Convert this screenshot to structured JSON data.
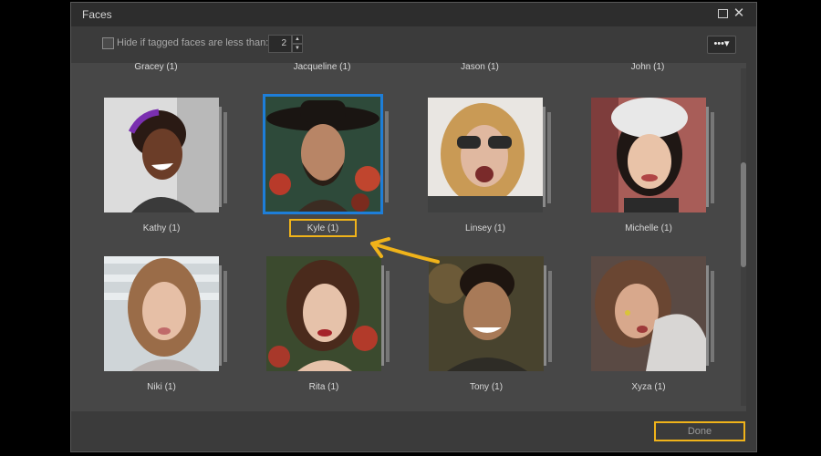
{
  "window": {
    "title": "Faces",
    "maximize_icon": "maximize-icon",
    "close_icon": "close-icon",
    "close_glyph": "✕"
  },
  "toolbar": {
    "hide_label": "Hide if tagged faces are less than:",
    "threshold": "2",
    "more_label": "•••▾"
  },
  "top_names": [
    "Gracey (1)",
    "Jacqueline (1)",
    "Jason (1)",
    "John (1)"
  ],
  "faces": [
    {
      "name": "Kathy (1)",
      "selected": false
    },
    {
      "name": "Kyle (1)",
      "selected": true
    },
    {
      "name": "Linsey (1)",
      "selected": false
    },
    {
      "name": "Michelle (1)",
      "selected": false
    },
    {
      "name": "Niki (1)",
      "selected": false
    },
    {
      "name": "Rita (1)",
      "selected": false
    },
    {
      "name": "Tony (1)",
      "selected": false
    },
    {
      "name": "Xyza (1)",
      "selected": false
    }
  ],
  "footer": {
    "done_label": "Done"
  },
  "colors": {
    "accent": "#1e7ed8",
    "highlight": "#f0b31a"
  }
}
